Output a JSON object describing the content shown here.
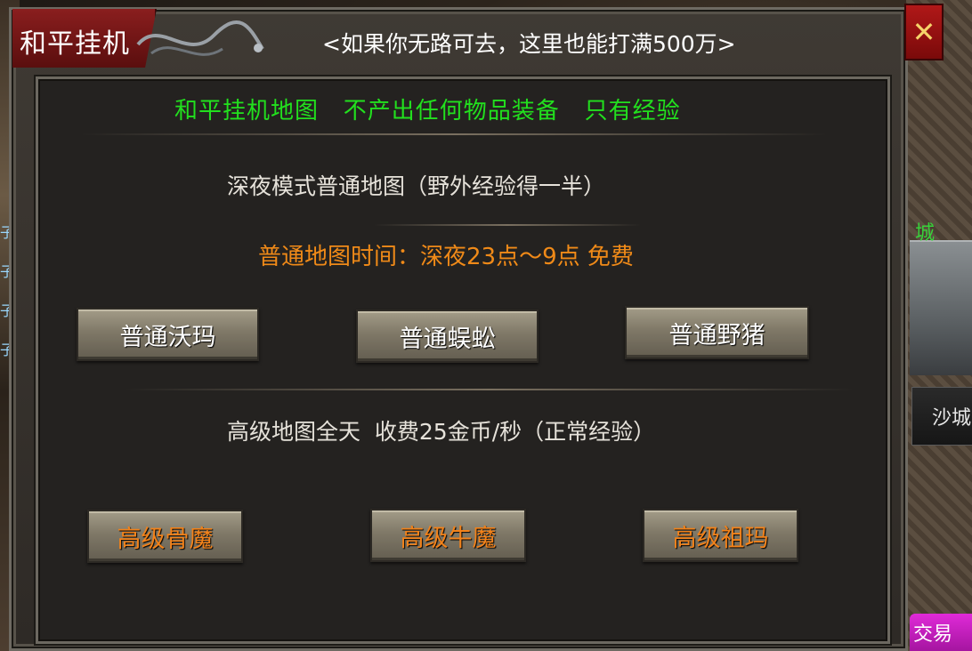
{
  "window": {
    "title": "和平挂机",
    "subtitle": "<如果你无路可去，这里也能打满500万>",
    "close_icon": "close-icon"
  },
  "panel": {
    "headline": "和平挂机地图   不产出任何物品装备   只有经验",
    "normal_caption": "深夜模式普通地图（野外经验得一半）",
    "normal_time": "普通地图时间：深夜23点～9点  免费",
    "normal_buttons": [
      "普通沃玛",
      "普通蜈蚣",
      "普通野猪"
    ],
    "advanced_caption": "高级地图全天  收费25金币/秒（正常经验）",
    "advanced_buttons": [
      "高级骨魔",
      "高级牛魔",
      "高级祖玛"
    ]
  },
  "background": {
    "city_label": "城",
    "shacheng_tab": "沙城",
    "trade_button": "交易",
    "left_glyphs": [
      "子",
      "子",
      "子",
      "子"
    ]
  },
  "colors": {
    "headline": "#22e01e",
    "time_text": "#f08a18",
    "advanced_button_text": "#f2821a",
    "title_plate": "#8a1e1e",
    "close_button": "#b01818"
  }
}
